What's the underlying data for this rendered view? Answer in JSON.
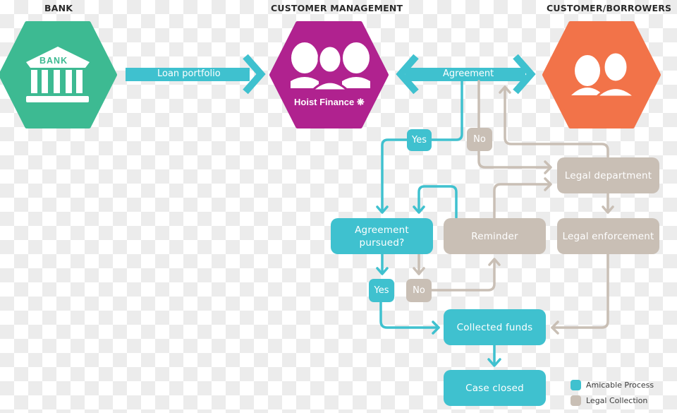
{
  "headers": {
    "bank": "BANK",
    "customer_management": "CUSTOMER MANAGEMENT",
    "customers": "CUSTOMER/BORROWERS"
  },
  "nodes": {
    "bank": {
      "icon": "bank-building-icon",
      "icon_text": "BANK",
      "color": "#3dba92"
    },
    "hoist": {
      "icon": "customer-service-team-icon",
      "label": "Hoist Finance",
      "logo": "hoist-finance-logo-icon",
      "color": "#b0228f"
    },
    "customers": {
      "icon": "customers-couple-icon",
      "color": "#f27349"
    }
  },
  "arrows": {
    "loan_portfolio": "Loan portfolio",
    "agreement": "Agreement"
  },
  "flow": {
    "yes_top": "Yes",
    "no_top": "No",
    "agreement_pursued": "Agreement pursued?",
    "reminder": "Reminder",
    "legal_department": "Legal department",
    "legal_enforcement": "Legal enforcement",
    "yes_bottom": "Yes",
    "no_bottom": "No",
    "collected_funds": "Collected funds",
    "case_closed": "Case closed"
  },
  "legend": [
    {
      "label": "Amicable Process",
      "color": "#3fc1cf"
    },
    {
      "label": "Legal Collection",
      "color": "#c9bfb5"
    }
  ],
  "colors": {
    "amicable": "#3fc1cf",
    "legal": "#c9bfb5"
  }
}
